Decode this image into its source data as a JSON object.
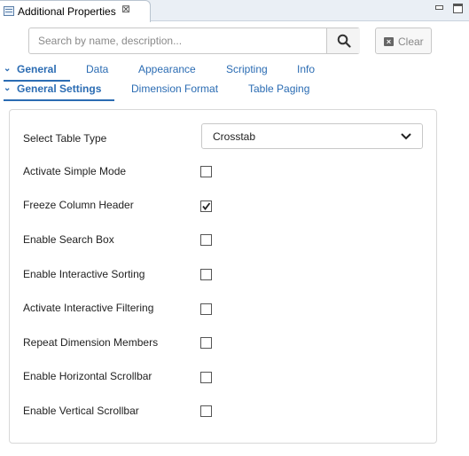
{
  "window": {
    "title": "Additional Properties",
    "close_glyph": "⊠"
  },
  "search": {
    "placeholder": "Search by name, description...",
    "value": "",
    "clear_label": "Clear"
  },
  "tabs": {
    "main": [
      {
        "label": "General",
        "active": true
      },
      {
        "label": "Data",
        "active": false
      },
      {
        "label": "Appearance",
        "active": false
      },
      {
        "label": "Scripting",
        "active": false
      },
      {
        "label": "Info",
        "active": false
      }
    ],
    "sub": [
      {
        "label": "General Settings",
        "active": true
      },
      {
        "label": "Dimension Format",
        "active": false
      },
      {
        "label": "Table Paging",
        "active": false
      }
    ]
  },
  "settings": {
    "table_type": {
      "label": "Select Table Type",
      "value": "Crosstab"
    },
    "options": [
      {
        "label": "Activate Simple Mode",
        "checked": false
      },
      {
        "label": "Freeze Column Header",
        "checked": true
      },
      {
        "label": "Enable Search Box",
        "checked": false
      },
      {
        "label": "Enable Interactive Sorting",
        "checked": false
      },
      {
        "label": "Activate Interactive Filtering",
        "checked": false
      },
      {
        "label": "Repeat Dimension Members",
        "checked": false
      },
      {
        "label": "Enable Horizontal Scrollbar",
        "checked": false
      },
      {
        "label": "Enable Vertical Scrollbar",
        "checked": false
      }
    ]
  },
  "colors": {
    "accent": "#2b6cb3",
    "titlebar": "#eaeff5"
  },
  "icons": {
    "view": "properties-view-icon",
    "close": "close-icon",
    "minimize": "minimize-icon",
    "maximize": "maximize-icon",
    "search": "search-icon",
    "clear": "clear-x-icon",
    "dropdown": "chevron-down-icon",
    "check": "checkmark-icon"
  }
}
